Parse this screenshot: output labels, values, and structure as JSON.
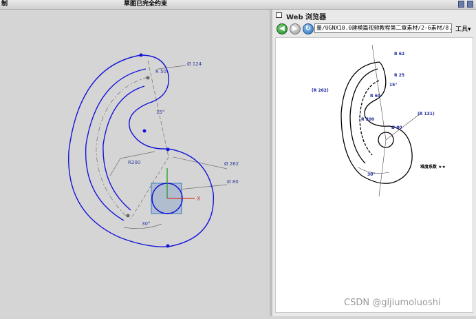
{
  "titlebar": {
    "left_label": "制",
    "center_title": "草图已完全约束"
  },
  "sketch": {
    "dims": {
      "d124": "Ø 124",
      "r50": "R 50",
      "a15": "15°",
      "r200": "R200",
      "d262": "Ø 262",
      "d80": "Ø 80",
      "a30": "30°"
    },
    "axis_x": "X"
  },
  "browser": {
    "panel_title": "Web 浏览器",
    "address": "量/UGNX10.0建模篇视频教程第二章素材/2-6素材/8.jpg",
    "tools_label": "工具▾",
    "drawing": {
      "r62": "R 62",
      "r25": "R 25",
      "a15": "15°",
      "r262": "(R 262)",
      "r60": "R 60",
      "r200": "R 200",
      "d80": "Ø 80",
      "r131": "(R 131)",
      "a30": "30°",
      "difficulty": "难度系数 ★★"
    }
  },
  "watermark": "CSDN @gljiumoluoshi"
}
